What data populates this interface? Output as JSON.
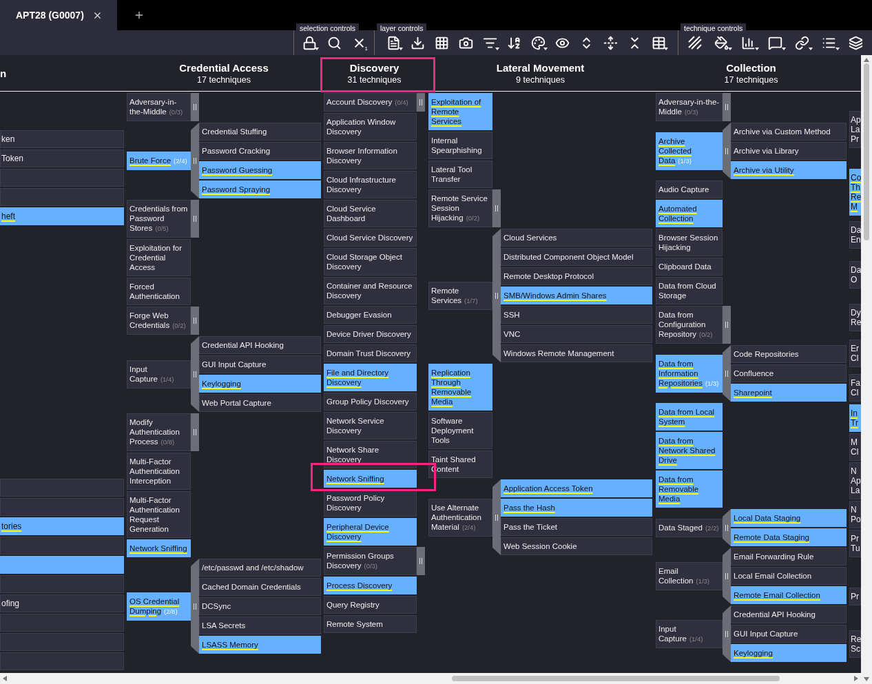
{
  "tab": {
    "title": "APT28 (G0007)"
  },
  "toolbar": {
    "groups": [
      {
        "label": "selection controls"
      },
      {
        "label": "layer controls"
      },
      {
        "label": "technique controls"
      }
    ],
    "selection_badge": "1"
  },
  "matrix": {
    "clipped_left": {
      "header": "n",
      "cells": [
        {
          "text": "ken",
          "selected": false
        },
        {
          "text": "Token",
          "selected": false
        },
        {
          "selected": false
        },
        {
          "selected": false
        },
        {
          "text": "heft",
          "selected": true
        },
        {
          "selected": false
        },
        {
          "selected": false
        },
        {
          "text": "tories",
          "selected": true
        },
        {
          "selected": false
        },
        {
          "selected": true
        },
        {
          "selected": false
        },
        {
          "text": "ofing",
          "selected": false
        },
        {
          "selected": false
        },
        {
          "selected": false
        },
        {
          "selected": false
        }
      ]
    },
    "tactics": [
      {
        "name": "Credential Access",
        "count": "17 techniques",
        "header_framed": false,
        "techniques": [
          {
            "name": "Adversary-in-the-Middle",
            "count": "(0/3)",
            "selected": false
          },
          {
            "name": "Brute Force",
            "count": "(2/4)",
            "selected": true,
            "subtechniques": [
              {
                "name": "Credential Stuffing",
                "selected": false
              },
              {
                "name": "Password Cracking",
                "selected": false
              },
              {
                "name": "Password Guessing",
                "selected": true
              },
              {
                "name": "Password Spraying",
                "selected": true
              }
            ]
          },
          {
            "name": "Credentials from Password Stores",
            "count": "(0/5)",
            "selected": false
          },
          {
            "name": "Exploitation for Credential Access",
            "selected": false
          },
          {
            "name": "Forced Authentication",
            "selected": false
          },
          {
            "name": "Forge Web Credentials",
            "count": "(0/2)",
            "selected": false
          },
          {
            "name": "Input Capture",
            "count": "(1/4)",
            "selected": false,
            "subtechniques": [
              {
                "name": "Credential API Hooking",
                "selected": false
              },
              {
                "name": "GUI Input Capture",
                "selected": false
              },
              {
                "name": "Keylogging",
                "selected": true
              },
              {
                "name": "Web Portal Capture",
                "selected": false
              }
            ]
          },
          {
            "name": "Modify Authentication Process",
            "count": "(0/8)",
            "selected": false
          },
          {
            "name": "Multi-Factor Authentication Interception",
            "selected": false
          },
          {
            "name": "Multi-Factor Authentication Request Generation",
            "selected": false
          },
          {
            "name": "Network Sniffing",
            "selected": true
          },
          {
            "name": "OS Credential Dumping",
            "count": "(2/8)",
            "selected": true,
            "subtechniques": [
              {
                "name": "/etc/passwd and /etc/shadow",
                "selected": false
              },
              {
                "name": "Cached Domain Credentials",
                "selected": false
              },
              {
                "name": "DCSync",
                "selected": false
              },
              {
                "name": "LSA Secrets",
                "selected": false
              },
              {
                "name": "LSASS Memory",
                "selected": true
              }
            ]
          }
        ]
      },
      {
        "name": "Discovery",
        "count": "31 techniques",
        "header_framed": true,
        "techniques": [
          {
            "name": "Account Discovery",
            "count": "(0/4)",
            "selected": false,
            "framed": false
          },
          {
            "name": "Application Window Discovery",
            "selected": false,
            "framed": false
          },
          {
            "name": "Browser Information Discovery",
            "selected": false,
            "framed": false
          },
          {
            "name": "Cloud Infrastructure Discovery",
            "selected": false,
            "framed": false
          },
          {
            "name": "Cloud Service Dashboard",
            "selected": false,
            "framed": false
          },
          {
            "name": "Cloud Service Discovery",
            "selected": false,
            "framed": false
          },
          {
            "name": "Cloud Storage Object Discovery",
            "selected": false,
            "framed": false
          },
          {
            "name": "Container and Resource Discovery",
            "selected": false,
            "framed": false
          },
          {
            "name": "Debugger Evasion",
            "selected": false,
            "framed": false
          },
          {
            "name": "Device Driver Discovery",
            "selected": false,
            "framed": false
          },
          {
            "name": "Domain Trust Discovery",
            "selected": false,
            "framed": false
          },
          {
            "name": "File and Directory Discovery",
            "selected": true,
            "framed": false
          },
          {
            "name": "Group Policy Discovery",
            "selected": false,
            "framed": false
          },
          {
            "name": "Network Service Discovery",
            "selected": false,
            "framed": false
          },
          {
            "name": "Network Share Discovery",
            "selected": false,
            "framed": false
          },
          {
            "name": "Network Sniffing",
            "selected": true,
            "framed": true
          },
          {
            "name": "Password Policy Discovery",
            "selected": false,
            "framed": false
          },
          {
            "name": "Peripheral Device Discovery",
            "selected": true,
            "framed": false
          },
          {
            "name": "Permission Groups Discovery",
            "count": "(0/3)",
            "selected": false,
            "framed": false
          },
          {
            "name": "Process Discovery",
            "selected": true,
            "framed": false
          },
          {
            "name": "Query Registry",
            "selected": false,
            "framed": false
          },
          {
            "name": "Remote System",
            "selected": false,
            "framed": false
          }
        ]
      },
      {
        "name": "Lateral Movement",
        "count": "9 techniques",
        "header_framed": false,
        "techniques": [
          {
            "name": "Exploitation of Remote Services",
            "selected": true
          },
          {
            "name": "Internal Spearphishing",
            "selected": false
          },
          {
            "name": "Lateral Tool Transfer",
            "selected": false
          },
          {
            "name": "Remote Service Session Hijacking",
            "count": "(0/2)",
            "selected": false
          },
          {
            "name": "Remote Services",
            "count": "(1/7)",
            "selected": false,
            "subtechniques": [
              {
                "name": "Cloud Services",
                "selected": false
              },
              {
                "name": "Distributed Component Object Model",
                "selected": false
              },
              {
                "name": "Remote Desktop Protocol",
                "selected": false
              },
              {
                "name": "SMB/Windows Admin Shares",
                "selected": true
              },
              {
                "name": "SSH",
                "selected": false
              },
              {
                "name": "VNC",
                "selected": false
              },
              {
                "name": "Windows Remote Management",
                "selected": false
              }
            ]
          },
          {
            "name": "Replication Through Removable Media",
            "selected": true
          },
          {
            "name": "Software Deployment Tools",
            "selected": false
          },
          {
            "name": "Taint Shared Content",
            "selected": false
          },
          {
            "name": "Use Alternate Authentication Material",
            "count": "(2/4)",
            "selected": false,
            "subtechniques": [
              {
                "name": "Application Access Token",
                "selected": true
              },
              {
                "name": "Pass the Hash",
                "selected": true
              },
              {
                "name": "Pass the Ticket",
                "selected": false
              },
              {
                "name": "Web Session Cookie",
                "selected": false
              }
            ]
          }
        ]
      },
      {
        "name": "Collection",
        "count": "17 techniques",
        "header_framed": false,
        "techniques": [
          {
            "name": "Adversary-in-the-Middle",
            "count": "(0/3)",
            "selected": false
          },
          {
            "name": "Archive Collected Data",
            "count": "(1/3)",
            "selected": true,
            "subtechniques": [
              {
                "name": "Archive via Custom Method",
                "selected": false
              },
              {
                "name": "Archive via Library",
                "selected": false
              },
              {
                "name": "Archive via Utility",
                "selected": true
              }
            ]
          },
          {
            "name": "Audio Capture",
            "selected": false
          },
          {
            "name": "Automated Collection",
            "selected": true
          },
          {
            "name": "Browser Session Hijacking",
            "selected": false
          },
          {
            "name": "Clipboard Data",
            "selected": false
          },
          {
            "name": "Data from Cloud Storage",
            "selected": false
          },
          {
            "name": "Data from Configuration Repository",
            "count": "(0/2)",
            "selected": false
          },
          {
            "name": "Data from Information Repositories",
            "count": "(1/3)",
            "selected": true,
            "subtechniques": [
              {
                "name": "Code Repositories",
                "selected": false
              },
              {
                "name": "Confluence",
                "selected": false
              },
              {
                "name": "Sharepoint",
                "selected": true
              }
            ]
          },
          {
            "name": "Data from Local System",
            "selected": true
          },
          {
            "name": "Data from Network Shared Drive",
            "selected": true
          },
          {
            "name": "Data from Removable Media",
            "selected": true
          },
          {
            "name": "Data Staged",
            "count": "(2/2)",
            "selected": false,
            "subtechniques": [
              {
                "name": "Local Data Staging",
                "selected": true
              },
              {
                "name": "Remote Data Staging",
                "selected": true
              }
            ]
          },
          {
            "name": "Email Collection",
            "count": "(1/3)",
            "selected": false,
            "subtechniques": [
              {
                "name": "Email Forwarding Rule",
                "selected": false
              },
              {
                "name": "Local Email Collection",
                "selected": false
              },
              {
                "name": "Remote Email Collection",
                "selected": true
              }
            ]
          },
          {
            "name": "Input Capture",
            "count": "(1/4)",
            "selected": false,
            "subtechniques": [
              {
                "name": "Credential API Hooking",
                "selected": false
              },
              {
                "name": "GUI Input Capture",
                "selected": false
              },
              {
                "name": "Keylogging",
                "selected": true
              }
            ]
          }
        ]
      }
    ],
    "clipped_right": {
      "cells": [
        {
          "text": "Ap La Pr",
          "selected": false
        },
        {
          "text": "Co Th Re M",
          "selected": true
        },
        {
          "text": "Da En",
          "selected": false
        },
        {
          "text": "Da O",
          "selected": false
        },
        {
          "text": "Dy Re",
          "selected": false
        },
        {
          "text": "Er Cl",
          "selected": false
        },
        {
          "text": "Fa Cl",
          "selected": false
        },
        {
          "text": "In Tr",
          "selected": true
        },
        {
          "text": "M Cl",
          "selected": false
        },
        {
          "text": "N Ap La",
          "selected": false
        },
        {
          "text": "N Po",
          "selected": false
        },
        {
          "text": "Pr Tu",
          "selected": false
        },
        {
          "text": "Pr",
          "selected": false
        },
        {
          "text": "Re Sc",
          "selected": false
        }
      ]
    }
  }
}
